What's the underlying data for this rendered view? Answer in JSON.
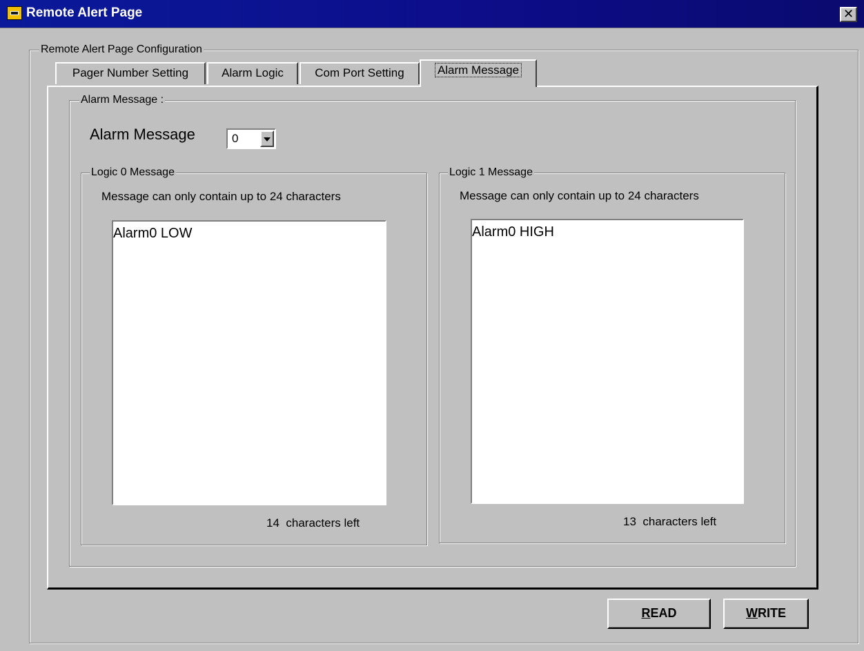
{
  "window": {
    "title": "Remote Alert Page",
    "close_glyph": "✕"
  },
  "config_group": {
    "legend": "Remote Alert Page Configuration"
  },
  "tabs": [
    {
      "label": "Pager Number Setting",
      "active": false
    },
    {
      "label": "Alarm Logic",
      "active": false
    },
    {
      "label": "Com Port Setting",
      "active": false
    },
    {
      "label": "Alarm Message",
      "active": true
    }
  ],
  "alarm_message_group": {
    "legend": "Alarm Message :",
    "selector_label": "Alarm Message",
    "selector_value": "0"
  },
  "logic0": {
    "legend": "Logic 0 Message",
    "hint": "Message can only contain up to 24 characters",
    "text": "Alarm0 LOW",
    "chars_left": "14",
    "chars_left_label": "characters left"
  },
  "logic1": {
    "legend": "Logic 1 Message",
    "hint": "Message can only contain up to 24 characters",
    "text": "Alarm0 HIGH",
    "chars_left": "13",
    "chars_left_label": "characters left"
  },
  "buttons": {
    "read_first": "R",
    "read_rest": "EAD",
    "write_first": "W",
    "write_rest": "RITE"
  },
  "colors": {
    "titlebar": "#0a1a9a",
    "face": "#c0c0c0",
    "app_icon": "#f2c000"
  }
}
